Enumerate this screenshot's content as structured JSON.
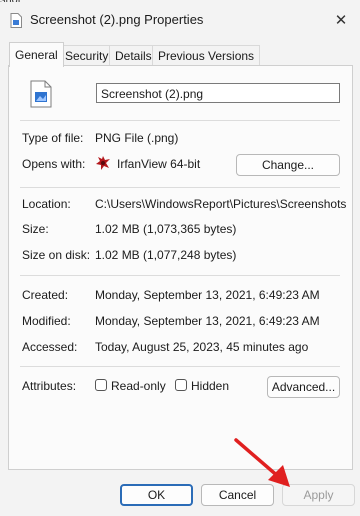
{
  "window": {
    "title": "Screenshot (2).png Properties",
    "above_snippet": "snot",
    "close_glyph": "✕"
  },
  "tabs": [
    {
      "label": "General"
    },
    {
      "label": "Security"
    },
    {
      "label": "Details"
    },
    {
      "label": "Previous Versions"
    }
  ],
  "general": {
    "filename": "Screenshot (2).png",
    "type_label": "Type of file:",
    "type_value": "PNG File (.png)",
    "opens_label": "Opens with:",
    "opens_value": "IrfanView 64-bit",
    "change_button": "Change...",
    "location_label": "Location:",
    "location_value": "C:\\Users\\WindowsReport\\Pictures\\Screenshots",
    "size_label": "Size:",
    "size_value": "1.02 MB (1,073,365 bytes)",
    "size_disk_label": "Size on disk:",
    "size_disk_value": "1.02 MB (1,077,248 bytes)",
    "created_label": "Created:",
    "created_value": "Monday, September 13, 2021, 6:49:23 AM",
    "modified_label": "Modified:",
    "modified_value": "Monday, September 13, 2021, 6:49:23 AM",
    "accessed_label": "Accessed:",
    "accessed_value": "Today, August 25, 2023, 45 minutes ago",
    "attributes_label": "Attributes:",
    "readonly_label": "Read-only",
    "hidden_label": "Hidden",
    "advanced_button": "Advanced..."
  },
  "buttons": {
    "ok": "OK",
    "cancel": "Cancel",
    "apply": "Apply"
  },
  "colors": {
    "accent_border": "#2b6cb7",
    "annotation_arrow": "#e02020"
  }
}
